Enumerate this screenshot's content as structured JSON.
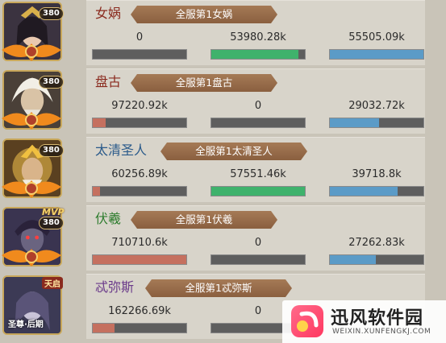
{
  "colors": {
    "bar_track": "#5e5e5e",
    "bar_red": "#c5705f",
    "bar_green": "#3fb26c",
    "bar_blue": "#5b9bc7"
  },
  "rows": [
    {
      "name": "女娲",
      "name_color": "#8a2a1e",
      "level": "380",
      "badge": "",
      "banner": "全服第1女娲",
      "stats": [
        {
          "value": "0",
          "fill": 0.0
        },
        {
          "value": "53980.28k",
          "fill": 0.93
        },
        {
          "value": "55505.09k",
          "fill": 1.0
        }
      ]
    },
    {
      "name": "盘古",
      "name_color": "#8a2a1e",
      "level": "380",
      "badge": "",
      "banner": "全服第1盘古",
      "stats": [
        {
          "value": "97220.92k",
          "fill": 0.14
        },
        {
          "value": "0",
          "fill": 0.0
        },
        {
          "value": "29032.72k",
          "fill": 0.53
        }
      ]
    },
    {
      "name": "太清圣人",
      "name_color": "#2a5a8a",
      "level": "380",
      "badge": "",
      "banner": "全服第1太清圣人",
      "stats": [
        {
          "value": "60256.89k",
          "fill": 0.08
        },
        {
          "value": "57551.46k",
          "fill": 1.0
        },
        {
          "value": "39718.8k",
          "fill": 0.72
        }
      ]
    },
    {
      "name": "伏羲",
      "name_color": "#2f7d2f",
      "level": "380",
      "badge": "MVP",
      "banner": "全服第1伏羲",
      "stats": [
        {
          "value": "710710.6k",
          "fill": 1.0
        },
        {
          "value": "0",
          "fill": 0.0
        },
        {
          "value": "27262.83k",
          "fill": 0.49
        }
      ]
    },
    {
      "name": "忒弥斯",
      "name_color": "#6a3a8a",
      "level": "",
      "badge": "天启",
      "stage": "圣尊·后期",
      "banner": "全服第1忒弥斯",
      "stats": [
        {
          "value": "162266.69k",
          "fill": 0.23
        },
        {
          "value": "0",
          "fill": 0.0
        },
        {
          "value": "",
          "fill": 0.0
        }
      ]
    }
  ],
  "watermark": {
    "title": "迅风软件园",
    "subtitle": "WEIXIN.XUNFENGKJ.COM"
  }
}
